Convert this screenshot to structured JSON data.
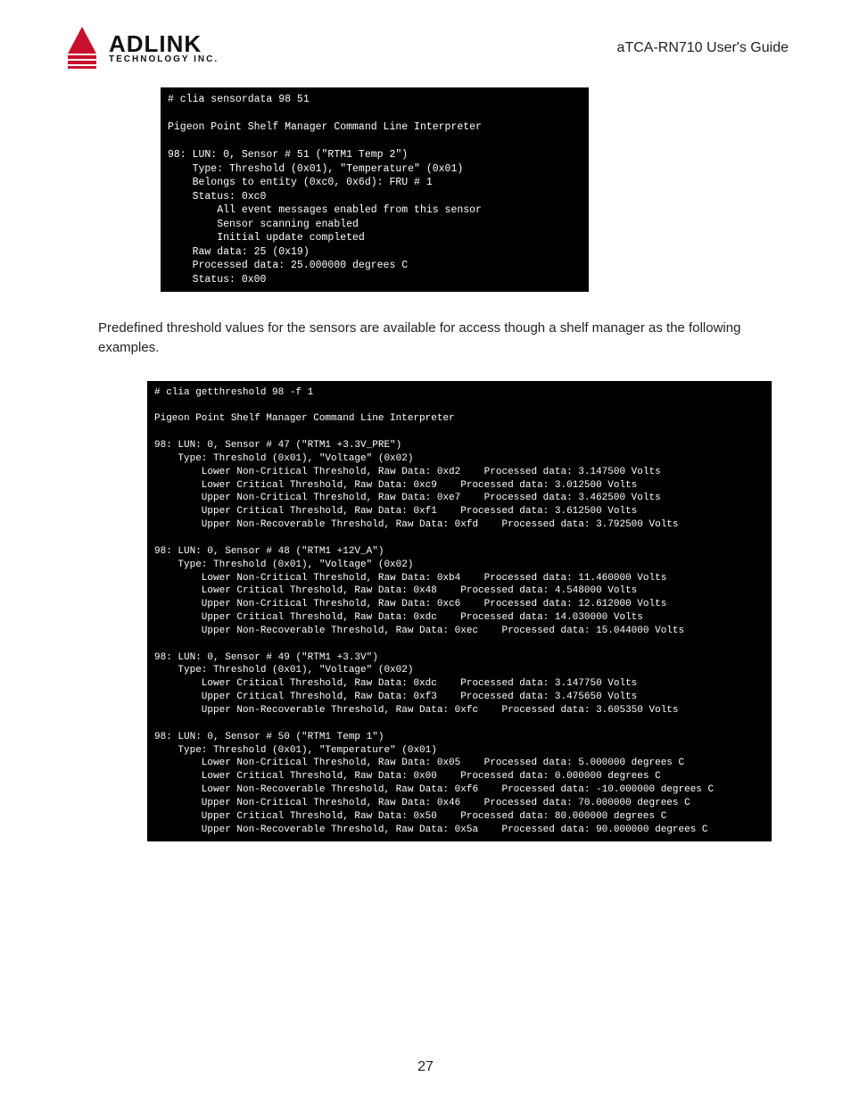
{
  "header": {
    "logo_name": "ADLINK",
    "logo_sub": "TECHNOLOGY INC.",
    "guide_title": "aTCA-RN710 User's Guide"
  },
  "terminal1": "# clia sensordata 98 51\n\nPigeon Point Shelf Manager Command Line Interpreter\n\n98: LUN: 0, Sensor # 51 (\"RTM1 Temp 2\")\n    Type: Threshold (0x01), \"Temperature\" (0x01)\n    Belongs to entity (0xc0, 0x6d): FRU # 1\n    Status: 0xc0\n        All event messages enabled from this sensor\n        Sensor scanning enabled\n        Initial update completed\n    Raw data: 25 (0x19)\n    Processed data: 25.000000 degrees C\n    Status: 0x00",
  "body_text": "Predefined threshold values for the sensors are available for access though a shelf manager as the following examples.",
  "terminal2": "# clia getthreshold 98 -f 1\n\nPigeon Point Shelf Manager Command Line Interpreter\n\n98: LUN: 0, Sensor # 47 (\"RTM1 +3.3V_PRE\")\n    Type: Threshold (0x01), \"Voltage\" (0x02)\n        Lower Non-Critical Threshold, Raw Data: 0xd2    Processed data: 3.147500 Volts\n        Lower Critical Threshold, Raw Data: 0xc9    Processed data: 3.012500 Volts\n        Upper Non-Critical Threshold, Raw Data: 0xe7    Processed data: 3.462500 Volts\n        Upper Critical Threshold, Raw Data: 0xf1    Processed data: 3.612500 Volts\n        Upper Non-Recoverable Threshold, Raw Data: 0xfd    Processed data: 3.792500 Volts\n\n98: LUN: 0, Sensor # 48 (\"RTM1 +12V_A\")\n    Type: Threshold (0x01), \"Voltage\" (0x02)\n        Lower Non-Critical Threshold, Raw Data: 0xb4    Processed data: 11.460000 Volts\n        Lower Critical Threshold, Raw Data: 0x48    Processed data: 4.548000 Volts\n        Upper Non-Critical Threshold, Raw Data: 0xc6    Processed data: 12.612000 Volts\n        Upper Critical Threshold, Raw Data: 0xdc    Processed data: 14.030000 Volts\n        Upper Non-Recoverable Threshold, Raw Data: 0xec    Processed data: 15.044000 Volts\n\n98: LUN: 0, Sensor # 49 (\"RTM1 +3.3V\")\n    Type: Threshold (0x01), \"Voltage\" (0x02)\n        Lower Critical Threshold, Raw Data: 0xdc    Processed data: 3.147750 Volts\n        Upper Critical Threshold, Raw Data: 0xf3    Processed data: 3.475650 Volts\n        Upper Non-Recoverable Threshold, Raw Data: 0xfc    Processed data: 3.605350 Volts\n\n98: LUN: 0, Sensor # 50 (\"RTM1 Temp 1\")\n    Type: Threshold (0x01), \"Temperature\" (0x01)\n        Lower Non-Critical Threshold, Raw Data: 0x05    Processed data: 5.000000 degrees C\n        Lower Critical Threshold, Raw Data: 0x00    Processed data: 0.000000 degrees C\n        Lower Non-Recoverable Threshold, Raw Data: 0xf6    Processed data: -10.000000 degrees C\n        Upper Non-Critical Threshold, Raw Data: 0x46    Processed data: 70.000000 degrees C\n        Upper Critical Threshold, Raw Data: 0x50    Processed data: 80.000000 degrees C\n        Upper Non-Recoverable Threshold, Raw Data: 0x5a    Processed data: 90.000000 degrees C\n",
  "page_number": "27"
}
